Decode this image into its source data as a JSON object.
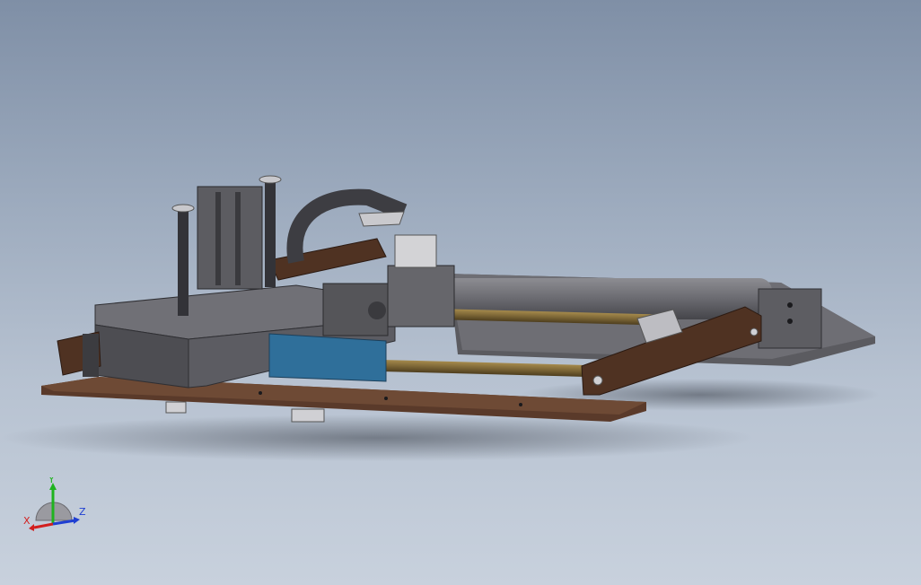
{
  "triad": {
    "x_label": "X",
    "y_label": "Y",
    "z_label": "Z",
    "x_color": "#d21f1f",
    "y_color": "#1fb31f",
    "z_color": "#1f3fd2"
  },
  "colors": {
    "wood": "#5a3a2a",
    "wood_dark": "#3f281d",
    "metal_dark": "#4d4d52",
    "metal_mid": "#6a6a70",
    "metal_light": "#a8a8ac",
    "brass": "#7c6636",
    "blue_block": "#2f6f9a"
  }
}
